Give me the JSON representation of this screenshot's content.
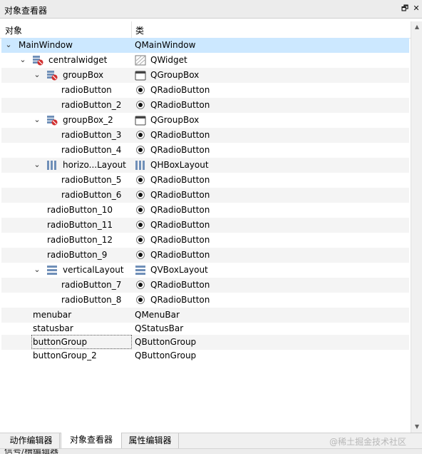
{
  "panel": {
    "title": "对象查看器",
    "float_glyph": "🗗",
    "close_glyph": "✕"
  },
  "headers": {
    "object": "对象",
    "class": "类"
  },
  "rows": [
    {
      "name": "MainWindow",
      "cls": "QMainWindow",
      "expander": "expanded",
      "obj_icon": "",
      "class_icon": ""
    },
    {
      "name": "centralwidget",
      "cls": "QWidget",
      "expander": "expanded",
      "obj_icon": "container-layout-off-icon",
      "class_icon": "widget-icon"
    },
    {
      "name": "groupBox",
      "cls": "QGroupBox",
      "expander": "expanded",
      "obj_icon": "container-layout-off-icon",
      "class_icon": "groupbox-icon"
    },
    {
      "name": "radioButton",
      "cls": "QRadioButton",
      "expander": "",
      "obj_icon": "",
      "class_icon": "radio-icon"
    },
    {
      "name": "radioButton_2",
      "cls": "QRadioButton",
      "expander": "",
      "obj_icon": "",
      "class_icon": "radio-icon"
    },
    {
      "name": "groupBox_2",
      "cls": "QGroupBox",
      "expander": "expanded",
      "obj_icon": "container-layout-off-icon",
      "class_icon": "groupbox-icon"
    },
    {
      "name": "radioButton_3",
      "cls": "QRadioButton",
      "expander": "",
      "obj_icon": "",
      "class_icon": "radio-icon"
    },
    {
      "name": "radioButton_4",
      "cls": "QRadioButton",
      "expander": "",
      "obj_icon": "",
      "class_icon": "radio-icon"
    },
    {
      "name": "horizo...Layout",
      "cls": "QHBoxLayout",
      "expander": "expanded",
      "obj_icon": "hbox-layout-icon",
      "class_icon": "hbox-layout-icon"
    },
    {
      "name": "radioButton_5",
      "cls": "QRadioButton",
      "expander": "",
      "obj_icon": "",
      "class_icon": "radio-icon"
    },
    {
      "name": "radioButton_6",
      "cls": "QRadioButton",
      "expander": "",
      "obj_icon": "",
      "class_icon": "radio-icon"
    },
    {
      "name": "radioButton_10",
      "cls": "QRadioButton",
      "expander": "",
      "obj_icon": "",
      "class_icon": "radio-icon"
    },
    {
      "name": "radioButton_11",
      "cls": "QRadioButton",
      "expander": "",
      "obj_icon": "",
      "class_icon": "radio-icon"
    },
    {
      "name": "radioButton_12",
      "cls": "QRadioButton",
      "expander": "",
      "obj_icon": "",
      "class_icon": "radio-icon"
    },
    {
      "name": "radioButton_9",
      "cls": "QRadioButton",
      "expander": "",
      "obj_icon": "",
      "class_icon": "radio-icon"
    },
    {
      "name": "verticalLayout",
      "cls": "QVBoxLayout",
      "expander": "expanded",
      "obj_icon": "vbox-layout-icon",
      "class_icon": "vbox-layout-icon"
    },
    {
      "name": "radioButton_7",
      "cls": "QRadioButton",
      "expander": "",
      "obj_icon": "",
      "class_icon": "radio-icon"
    },
    {
      "name": "radioButton_8",
      "cls": "QRadioButton",
      "expander": "",
      "obj_icon": "",
      "class_icon": "radio-icon"
    },
    {
      "name": "menubar",
      "cls": "QMenuBar",
      "expander": "",
      "obj_icon": "",
      "class_icon": ""
    },
    {
      "name": "statusbar",
      "cls": "QStatusBar",
      "expander": "",
      "obj_icon": "",
      "class_icon": ""
    },
    {
      "name": "buttonGroup",
      "cls": "QButtonGroup",
      "expander": "",
      "obj_icon": "",
      "class_icon": "",
      "focused": true
    },
    {
      "name": "buttonGroup_2",
      "cls": "QButtonGroup",
      "expander": "",
      "obj_icon": "",
      "class_icon": ""
    }
  ],
  "tabs": [
    {
      "label": "动作编辑器",
      "active": false
    },
    {
      "label": "对象查看器",
      "active": true
    },
    {
      "label": "属性编辑器",
      "active": false
    }
  ],
  "watermark": "@稀土掘金技术社区",
  "bottom_strip_text": "信号/槽编辑器",
  "colors": {
    "selection": "#cce8ff",
    "alt_row": "#f4f4f4",
    "header_bg": "#ececec"
  }
}
